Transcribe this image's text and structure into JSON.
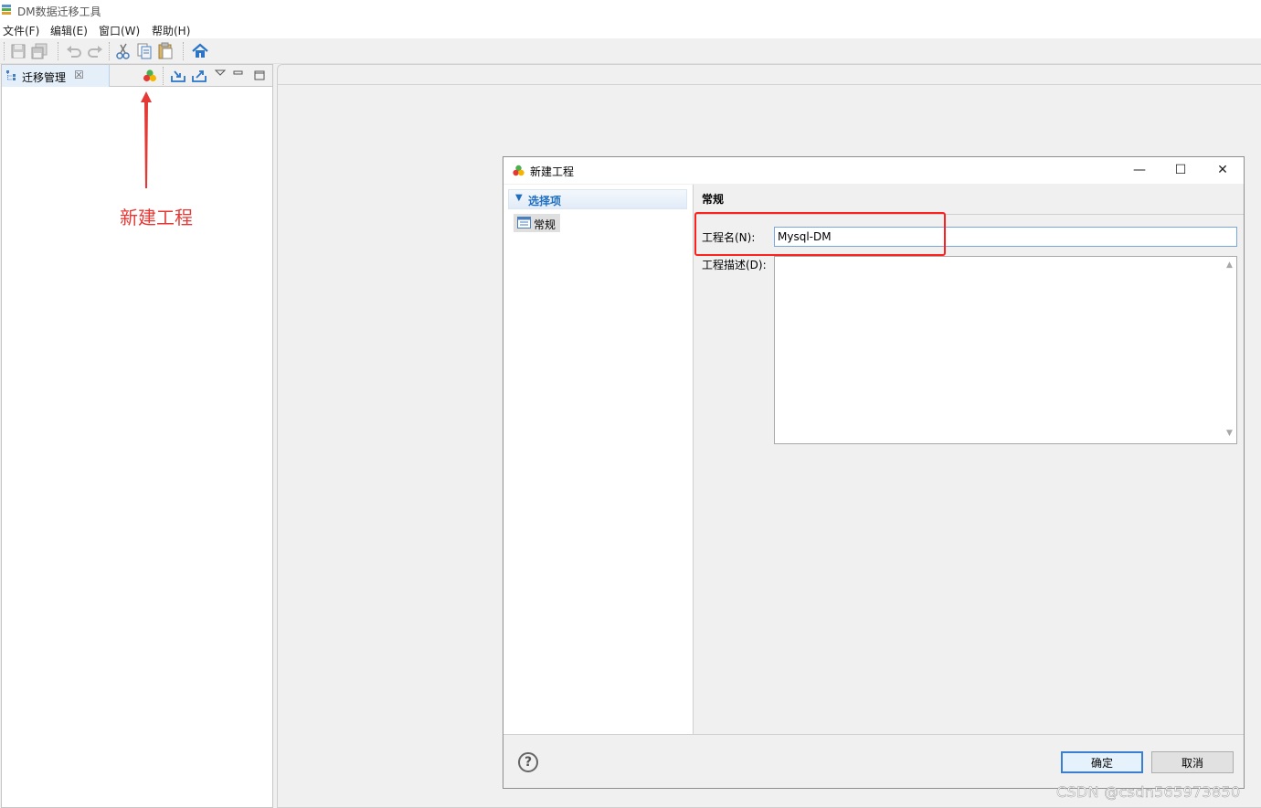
{
  "app": {
    "title": "DM数据迁移工具"
  },
  "menu": {
    "items": [
      {
        "label": "文件(F)"
      },
      {
        "label": "编辑(E)"
      },
      {
        "label": "窗口(W)"
      },
      {
        "label": "帮助(H)"
      }
    ]
  },
  "toolbar": {
    "buttons": [
      {
        "icon": "save-icon"
      },
      {
        "icon": "save-all-icon"
      },
      {
        "icon": "undo-icon"
      },
      {
        "icon": "redo-icon"
      },
      {
        "icon": "cut-icon"
      },
      {
        "icon": "copy-icon"
      },
      {
        "icon": "paste-icon"
      },
      {
        "icon": "home-icon"
      }
    ]
  },
  "view": {
    "tab_label": "迁移管理",
    "close_glyph": "☒",
    "buttons": [
      {
        "icon": "new-project-icon"
      },
      {
        "icon": "import-icon"
      },
      {
        "icon": "export-icon"
      },
      {
        "icon": "view-menu-icon"
      },
      {
        "icon": "minimize-icon"
      },
      {
        "icon": "maximize-icon"
      }
    ]
  },
  "annotation": {
    "text": "新建工程",
    "color": "#e53935"
  },
  "dialog": {
    "title": "新建工程",
    "window_buttons": {
      "minimize": "—",
      "maximize": "☐",
      "close": "✕"
    },
    "tree": {
      "root_label": "选择项",
      "root_arrow": "▼",
      "child_label": "常规"
    },
    "section_title": "常规",
    "fields": {
      "name_label": "工程名(N):",
      "name_value": "Mysql-DM",
      "desc_label": "工程描述(D):",
      "desc_value": ""
    },
    "help_glyph": "?",
    "ok_label": "确定",
    "cancel_label": "取消"
  },
  "watermark": {
    "text": "CSDN @csdn565973850"
  },
  "colors": {
    "accent": "#3b7fd2",
    "highlight": "#ff2020",
    "annotation": "#e53935"
  }
}
